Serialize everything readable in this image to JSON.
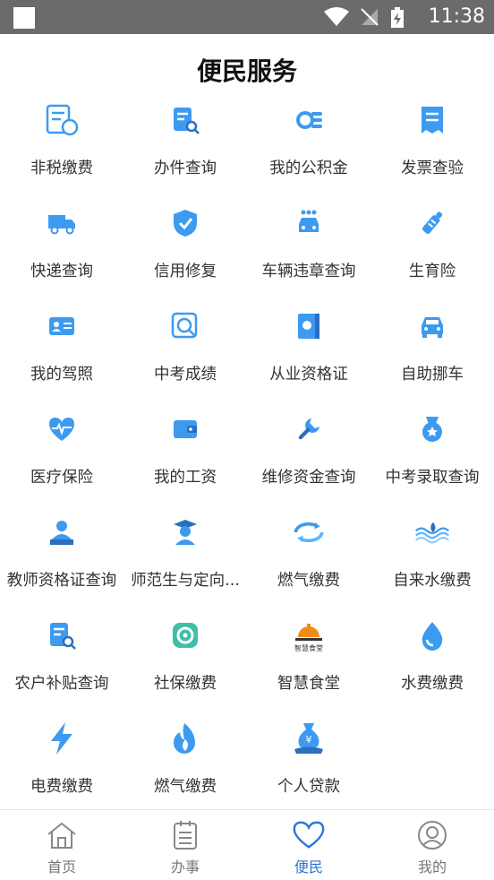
{
  "status_bar": {
    "time": "11:38"
  },
  "header": {
    "title": "便民服务"
  },
  "services": [
    {
      "label": "非税缴费",
      "icon": "tax-receipt-icon"
    },
    {
      "label": "办件查询",
      "icon": "document-search-icon"
    },
    {
      "label": "我的公积金",
      "icon": "coin-stack-icon"
    },
    {
      "label": "发票查验",
      "icon": "invoice-icon"
    },
    {
      "label": "快递查询",
      "icon": "delivery-truck-icon"
    },
    {
      "label": "信用修复",
      "icon": "shield-check-icon"
    },
    {
      "label": "车辆违章查询",
      "icon": "car-violation-icon"
    },
    {
      "label": "生育险",
      "icon": "baby-bottle-icon"
    },
    {
      "label": "我的驾照",
      "icon": "id-card-icon"
    },
    {
      "label": "中考成绩",
      "icon": "score-search-icon"
    },
    {
      "label": "从业资格证",
      "icon": "certificate-icon"
    },
    {
      "label": "自助挪车",
      "icon": "car-front-icon"
    },
    {
      "label": "医疗保险",
      "icon": "heart-pulse-icon"
    },
    {
      "label": "我的工资",
      "icon": "wallet-icon"
    },
    {
      "label": "维修资金查询",
      "icon": "wrench-icon"
    },
    {
      "label": "中考录取查询",
      "icon": "medal-icon"
    },
    {
      "label": "教师资格证查询",
      "icon": "teacher-icon"
    },
    {
      "label": "师范生与定向...",
      "icon": "graduate-icon"
    },
    {
      "label": "燃气缴费",
      "icon": "gas-arrows-icon"
    },
    {
      "label": "自来水缴费",
      "icon": "water-wave-icon"
    },
    {
      "label": "农户补贴查询",
      "icon": "document-search-icon"
    },
    {
      "label": "社保缴费",
      "icon": "social-security-icon"
    },
    {
      "label": "智慧食堂",
      "icon": "smart-canteen-logo-icon",
      "logo_text": "智慧食堂"
    },
    {
      "label": "水费缴费",
      "icon": "water-drop-icon"
    },
    {
      "label": "电费缴费",
      "icon": "lightning-icon"
    },
    {
      "label": "燃气缴费",
      "icon": "flame-icon"
    },
    {
      "label": "个人贷款",
      "icon": "money-bag-icon"
    }
  ],
  "tabbar": {
    "items": [
      {
        "label": "首页",
        "icon": "home-icon"
      },
      {
        "label": "办事",
        "icon": "clipboard-icon"
      },
      {
        "label": "便民",
        "icon": "heart-icon",
        "active": true
      },
      {
        "label": "我的",
        "icon": "user-circle-icon"
      }
    ]
  },
  "colors": {
    "accent": "#2a74d6",
    "icon_blue": "#3c9bf0",
    "status_bar": "#6b6b6b"
  }
}
